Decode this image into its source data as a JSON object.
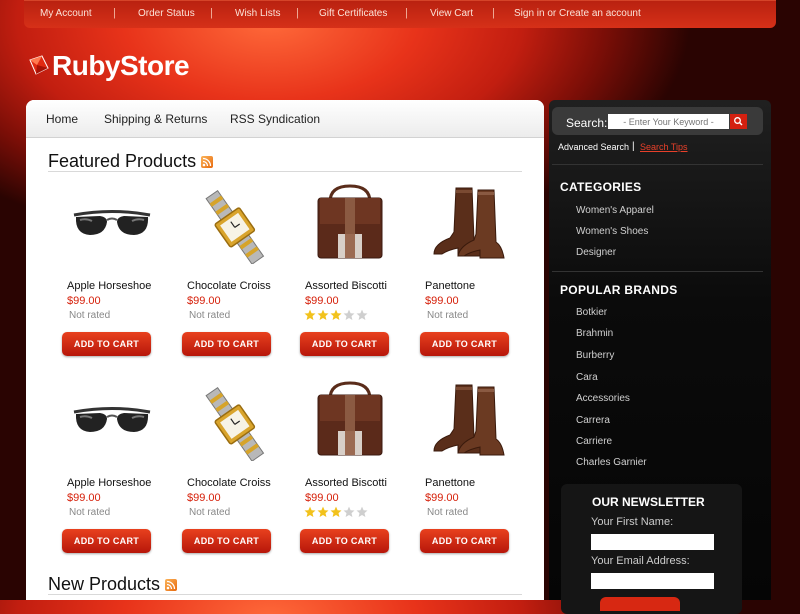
{
  "topnav": {
    "items": [
      "My Account",
      "Order Status",
      "Wish Lists",
      "Gift Certificates",
      "View Cart",
      "Sign in or Create an account"
    ],
    "separator": "|"
  },
  "logo": {
    "text": "RubyStore"
  },
  "menu": {
    "items": [
      "Home",
      "Shipping & Returns",
      "RSS Syndication"
    ]
  },
  "featured": {
    "title": "Featured Products",
    "rows": [
      [
        {
          "name": "Apple Horseshoe",
          "price": "$99.00",
          "rating_text": "Not rated",
          "icon": "sunglasses-icon"
        },
        {
          "name": "Chocolate Croiss",
          "price": "$99.00",
          "rating_text": "Not rated",
          "icon": "watch-icon"
        },
        {
          "name": "Assorted Biscotti",
          "price": "$99.00",
          "rating": 3,
          "max_rating": 5,
          "icon": "bag-icon"
        },
        {
          "name": "Panettone",
          "price": "$99.00",
          "rating_text": "Not rated",
          "icon": "boots-icon"
        }
      ],
      [
        {
          "name": "Apple Horseshoe",
          "price": "$99.00",
          "rating_text": "Not rated",
          "icon": "sunglasses-icon"
        },
        {
          "name": "Chocolate Croiss",
          "price": "$99.00",
          "rating_text": "Not rated",
          "icon": "watch-icon"
        },
        {
          "name": "Assorted Biscotti",
          "price": "$99.00",
          "rating": 3,
          "max_rating": 5,
          "icon": "bag-icon"
        },
        {
          "name": "Panettone",
          "price": "$99.00",
          "rating_text": "Not rated",
          "icon": "boots-icon"
        }
      ]
    ],
    "add_to_cart_label": "ADD TO CART"
  },
  "new_products": {
    "title": "New Products"
  },
  "search": {
    "label": "Search:",
    "placeholder": "- Enter Your Keyword -",
    "advanced_label": "Advanced Search",
    "separator": "|",
    "tips_label": "Search Tips"
  },
  "categories": {
    "title": "CATEGORIES",
    "items": [
      "Women's Apparel",
      "Women's Shoes",
      "Designer"
    ]
  },
  "brands": {
    "title": "POPULAR BRANDS",
    "items": [
      "Botkier",
      "Brahmin",
      "Burberry",
      "Cara",
      "Accessories",
      "Carrera",
      "Carriere",
      "Charles Garnier"
    ]
  },
  "newsletter": {
    "title": "OUR NEWSLETTER",
    "first_name_label": "Your First Name:",
    "email_label": "Your Email Address:"
  },
  "colors": {
    "accent": "#d6200a",
    "price": "#d6200a",
    "sidebar_bg": "#0b0b0b",
    "star_on": "#f2c21c",
    "star_off": "#cfcfcf"
  }
}
